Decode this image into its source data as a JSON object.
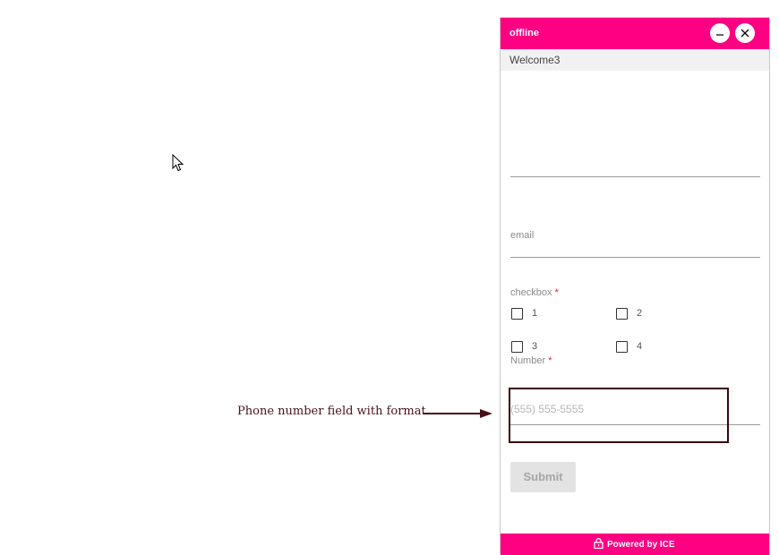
{
  "annotation": {
    "text": "Phone number field with format"
  },
  "widget": {
    "header": {
      "title": "offline"
    },
    "welcome": "Welcome3",
    "form": {
      "email_label": "email",
      "checkbox": {
        "label": "checkbox",
        "required_mark": "*",
        "options": [
          "1",
          "2",
          "3",
          "4"
        ]
      },
      "number": {
        "label": "Number",
        "required_mark": "*",
        "placeholder": "(555) 555-5555"
      },
      "submit_label": "Submit"
    },
    "footer": {
      "text": "Powered by ICE"
    }
  },
  "colors": {
    "accent": "#ff0082",
    "annotation": "#4a1018",
    "highlight_border": "#3a0610"
  },
  "icons": [
    "cursor-arrow",
    "minimize",
    "close",
    "lock"
  ]
}
